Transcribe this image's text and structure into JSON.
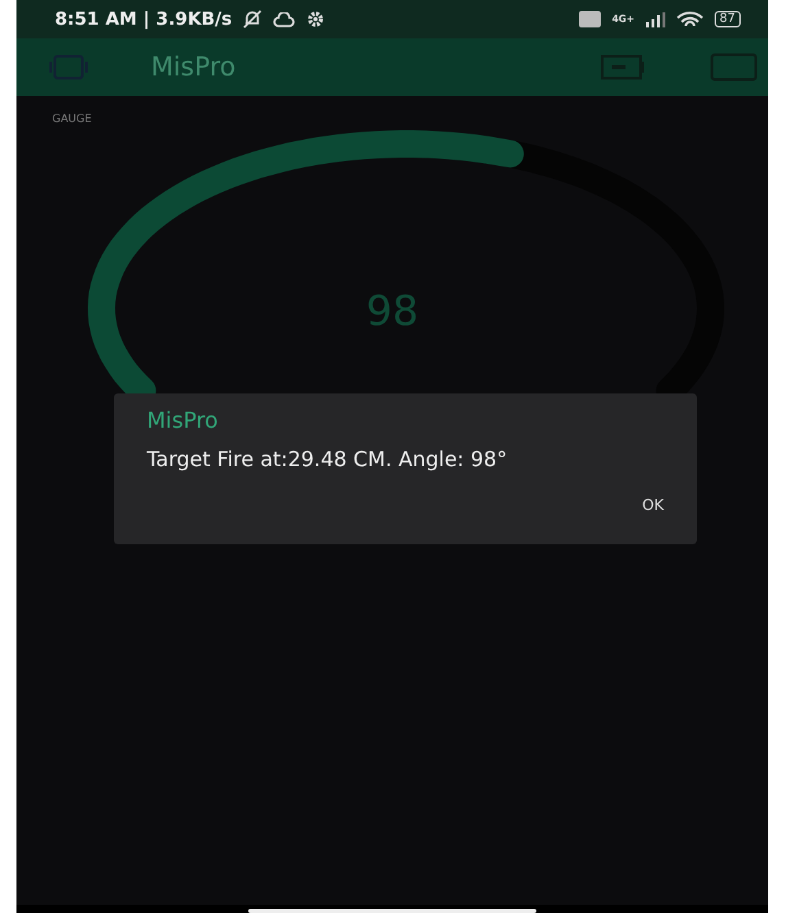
{
  "status_bar": {
    "time": "8:51 AM | 3.9KB/s",
    "network": "4G+",
    "battery": "87"
  },
  "app_bar": {
    "title": "MisPro"
  },
  "gauge": {
    "label": "GAUGE",
    "value": "98"
  },
  "dialog": {
    "title": "MisPro",
    "message": "Target Fire at:29.48 CM. Angle: 98°",
    "buttons": [
      "OK"
    ]
  }
}
